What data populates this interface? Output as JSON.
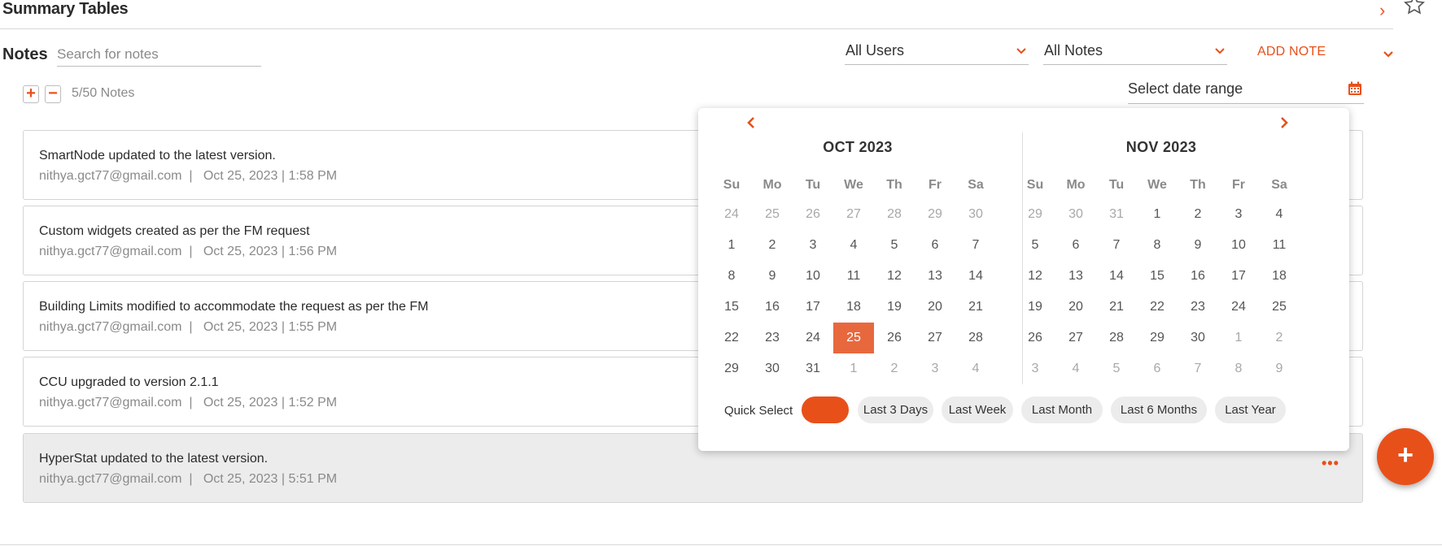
{
  "header": {
    "title": "Summary Tables"
  },
  "toolbar": {
    "notes_label": "Notes",
    "search_placeholder": "Search for notes",
    "users_select": "All Users",
    "notes_select": "All Notes",
    "add_note_label": "ADD NOTE",
    "count_text": "5/50 Notes",
    "date_range_placeholder": "Select date range"
  },
  "notes": [
    {
      "title": "SmartNode updated to the latest version.",
      "email": "nithya.gct77@gmail.com",
      "datetime": "Oct 25, 2023 | 1:58 PM"
    },
    {
      "title": "Custom widgets created as per the FM request",
      "email": "nithya.gct77@gmail.com",
      "datetime": "Oct 25, 2023 | 1:56 PM"
    },
    {
      "title": "Building Limits modified to accommodate the request as per the FM",
      "email": "nithya.gct77@gmail.com",
      "datetime": "Oct 25, 2023 | 1:55 PM"
    },
    {
      "title": "CCU upgraded to version 2.1.1",
      "email": "nithya.gct77@gmail.com",
      "datetime": "Oct 25, 2023 | 1:52 PM"
    },
    {
      "title": "HyperStat updated to the latest version.",
      "email": "nithya.gct77@gmail.com",
      "datetime": "Oct 25, 2023 | 5:51 PM"
    }
  ],
  "calendar": {
    "weekdays": [
      "Su",
      "Mo",
      "Tu",
      "We",
      "Th",
      "Fr",
      "Sa"
    ],
    "months": [
      {
        "title": "OCT 2023",
        "days": [
          [
            "24",
            "25",
            "26",
            "27",
            "28",
            "29",
            "30"
          ],
          [
            "1",
            "2",
            "3",
            "4",
            "5",
            "6",
            "7"
          ],
          [
            "8",
            "9",
            "10",
            "11",
            "12",
            "13",
            "14"
          ],
          [
            "15",
            "16",
            "17",
            "18",
            "19",
            "20",
            "21"
          ],
          [
            "22",
            "23",
            "24",
            "25",
            "26",
            "27",
            "28"
          ],
          [
            "29",
            "30",
            "31",
            "1",
            "2",
            "3",
            "4"
          ]
        ],
        "muted_leading": 7,
        "muted_trailing": 4,
        "selected": "25"
      },
      {
        "title": "NOV 2023",
        "days": [
          [
            "29",
            "30",
            "31",
            "1",
            "2",
            "3",
            "4"
          ],
          [
            "5",
            "6",
            "7",
            "8",
            "9",
            "10",
            "11"
          ],
          [
            "12",
            "13",
            "14",
            "15",
            "16",
            "17",
            "18"
          ],
          [
            "19",
            "20",
            "21",
            "22",
            "23",
            "24",
            "25"
          ],
          [
            "26",
            "27",
            "28",
            "29",
            "30",
            "1",
            "2"
          ],
          [
            "3",
            "4",
            "5",
            "6",
            "7",
            "8",
            "9"
          ]
        ],
        "muted_leading": 3,
        "muted_trailing": 9,
        "selected": null
      }
    ],
    "quick_select_label": "Quick Select",
    "quick_options": [
      "",
      "Last 3 Days",
      "Last Week",
      "Last Month",
      "Last 6 Months",
      "Last Year"
    ],
    "active_quick_index": 0
  },
  "colors": {
    "accent": "#e8501a",
    "selected_day": "#e8683d"
  }
}
